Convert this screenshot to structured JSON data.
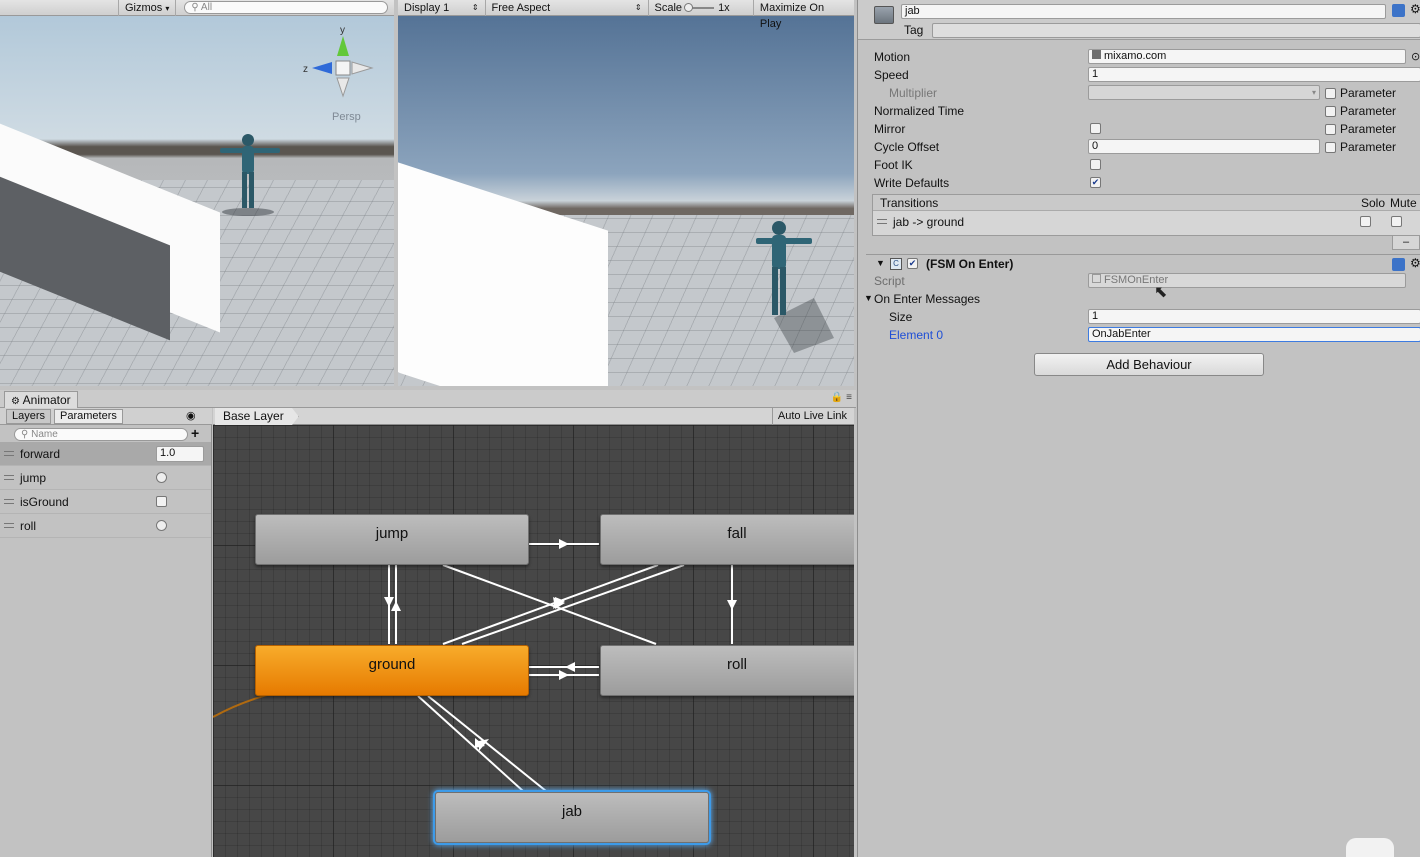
{
  "scene": {
    "gizmos_label": "Gizmos",
    "search_placeholder": "All",
    "gizmo_axis_y": "y",
    "gizmo_axis_z": "z",
    "projection_label": "Persp"
  },
  "game": {
    "display_label": "Display 1",
    "aspect_label": "Free Aspect",
    "scale_label": "Scale",
    "scale_value": "1x",
    "maximize_label": "Maximize On Play"
  },
  "animator": {
    "window_title": "Animator",
    "tabs": {
      "layers": "Layers",
      "parameters": "Parameters"
    },
    "param_search_placeholder": "Name",
    "add_symbol": "+",
    "parameters": [
      {
        "name": "forward",
        "value": "1.0"
      },
      {
        "name": "jump"
      },
      {
        "name": "isGround"
      },
      {
        "name": "roll"
      }
    ],
    "breadcrumb": "Base Layer",
    "auto_live_link": "Auto Live Link",
    "states": {
      "jump": "jump",
      "fall": "fall",
      "ground": "ground",
      "roll": "roll",
      "jab": "jab"
    }
  },
  "inspector": {
    "object_name": "jab",
    "tag_label": "Tag",
    "motion_label": "Motion",
    "motion_value": "mixamo.com",
    "speed_label": "Speed",
    "speed_value": "1",
    "multiplier_label": "Multiplier",
    "normalized_time_label": "Normalized Time",
    "mirror_label": "Mirror",
    "cycle_offset_label": "Cycle Offset",
    "cycle_offset_value": "0",
    "foot_ik_label": "Foot IK",
    "write_defaults_label": "Write Defaults",
    "parameter_label": "Parameter",
    "transitions_label": "Transitions",
    "solo_label": "Solo",
    "mute_label": "Mute",
    "transition_item": "jab -> ground",
    "minus_symbol": "–",
    "behaviour_title": "(FSM On Enter)",
    "script_label": "Script",
    "script_value": "FSMOnEnter",
    "on_enter_label": "On Enter Messages",
    "size_label": "Size",
    "size_value": "1",
    "element0_label": "Element 0",
    "element0_value": "OnJabEnter",
    "add_behaviour": "Add Behaviour"
  },
  "colors": {
    "default_state": "#f39a1b",
    "selection": "#3d9be9",
    "graph_bg": "#474747",
    "panel_bg": "#c2c2c2",
    "label_blue": "#1f4fd6"
  }
}
